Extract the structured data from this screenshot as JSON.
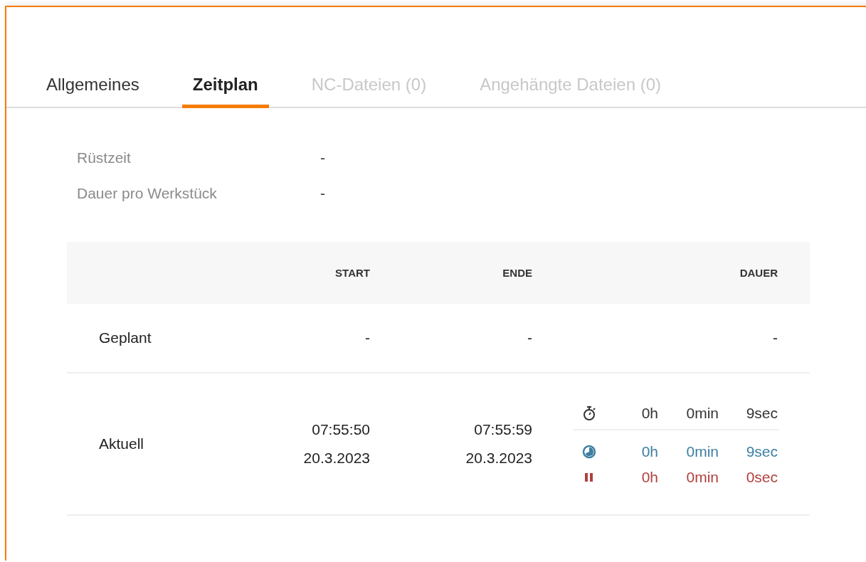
{
  "tabs": [
    {
      "label": "Allgemeines",
      "selected": false,
      "disabled": false
    },
    {
      "label": "Zeitplan",
      "selected": true,
      "disabled": false
    },
    {
      "label": "NC-Dateien (0)",
      "selected": false,
      "disabled": true
    },
    {
      "label": "Angehängte Dateien (0)",
      "selected": false,
      "disabled": true
    }
  ],
  "fields": [
    {
      "label": "Rüstzeit",
      "value": "-"
    },
    {
      "label": "Dauer pro Werkstück",
      "value": "-"
    }
  ],
  "table": {
    "columns": [
      "START",
      "ENDE",
      "DAUER"
    ],
    "rows": [
      {
        "label": "Geplant",
        "start": [
          "-"
        ],
        "end": [
          "-"
        ],
        "duration": {
          "kind": "plain",
          "text": "-"
        }
      },
      {
        "label": "Aktuell",
        "start": [
          "07:55:50",
          "20.3.2023"
        ],
        "end": [
          "07:55:59",
          "20.3.2023"
        ],
        "duration": {
          "kind": "breakdown",
          "lines": [
            {
              "kind": "total",
              "color": "#333333",
              "hours": "0h",
              "minutes": "0min",
              "seconds": "9sec"
            },
            {
              "kind": "running",
              "color": "#3d7fa0",
              "hours": "0h",
              "minutes": "0min",
              "seconds": "9sec"
            },
            {
              "kind": "paused",
              "color": "#b0413e",
              "hours": "0h",
              "minutes": "0min",
              "seconds": "0sec"
            }
          ]
        }
      }
    ]
  }
}
